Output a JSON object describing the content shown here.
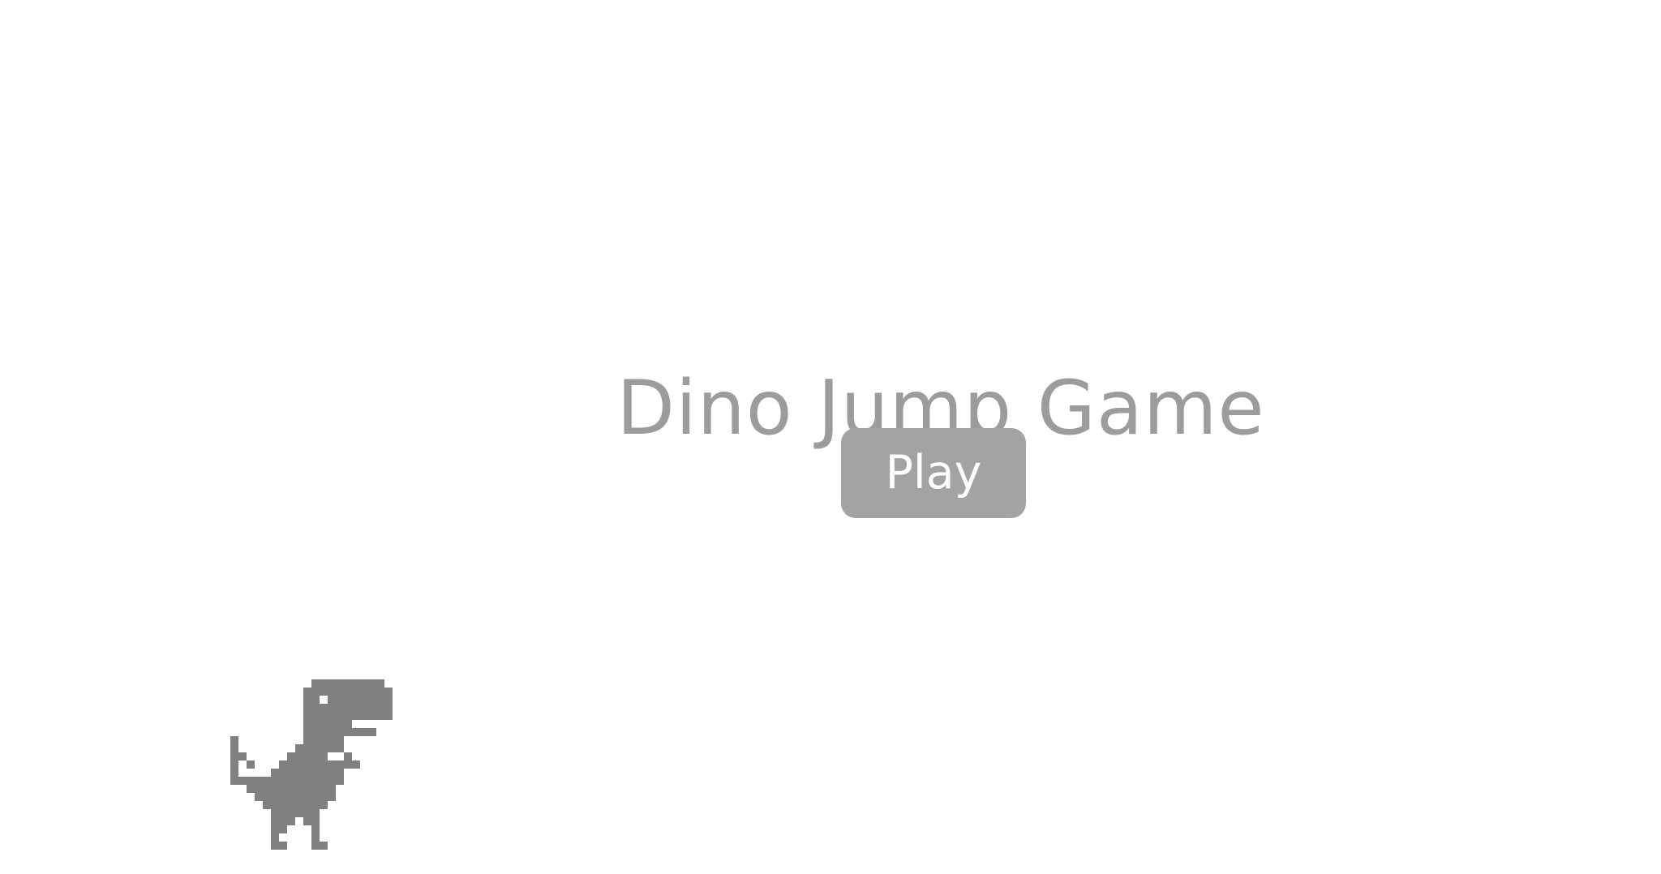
{
  "game": {
    "title": "Dino Jump Game",
    "play_label": "Play"
  },
  "colors": {
    "background": "#ffffff",
    "title": "#9c9c9c",
    "button_bg": "#a3a3a3",
    "button_text": "#ffffff",
    "dino": "#808080"
  },
  "icons": {
    "player_sprite": "t-rex-dino-icon"
  }
}
